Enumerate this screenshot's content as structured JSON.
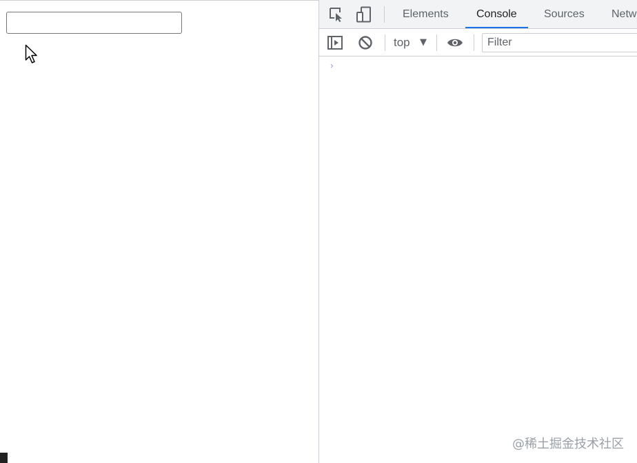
{
  "page": {
    "input_value": "",
    "input_placeholder": ""
  },
  "devtools": {
    "toolbar_icons": [
      "inspect-element-icon",
      "device-toolbar-icon"
    ],
    "tabs": [
      {
        "label": "Elements",
        "active": false
      },
      {
        "label": "Console",
        "active": true
      },
      {
        "label": "Sources",
        "active": false
      },
      {
        "label": "Netw",
        "active": false
      }
    ],
    "console_toolbar": {
      "sidebar_icon": "show-console-sidebar-icon",
      "clear_icon": "clear-console-icon",
      "context": "top",
      "context_arrow": "▼",
      "live_expression_icon": "eye-icon",
      "filter_placeholder": "Filter"
    },
    "prompt": "›"
  },
  "watermark": "@稀土掘金技术社区",
  "colors": {
    "active_tab_underline": "#1a73e8",
    "toolbar_bg": "#f1f3f4",
    "icon": "#5f6368"
  }
}
